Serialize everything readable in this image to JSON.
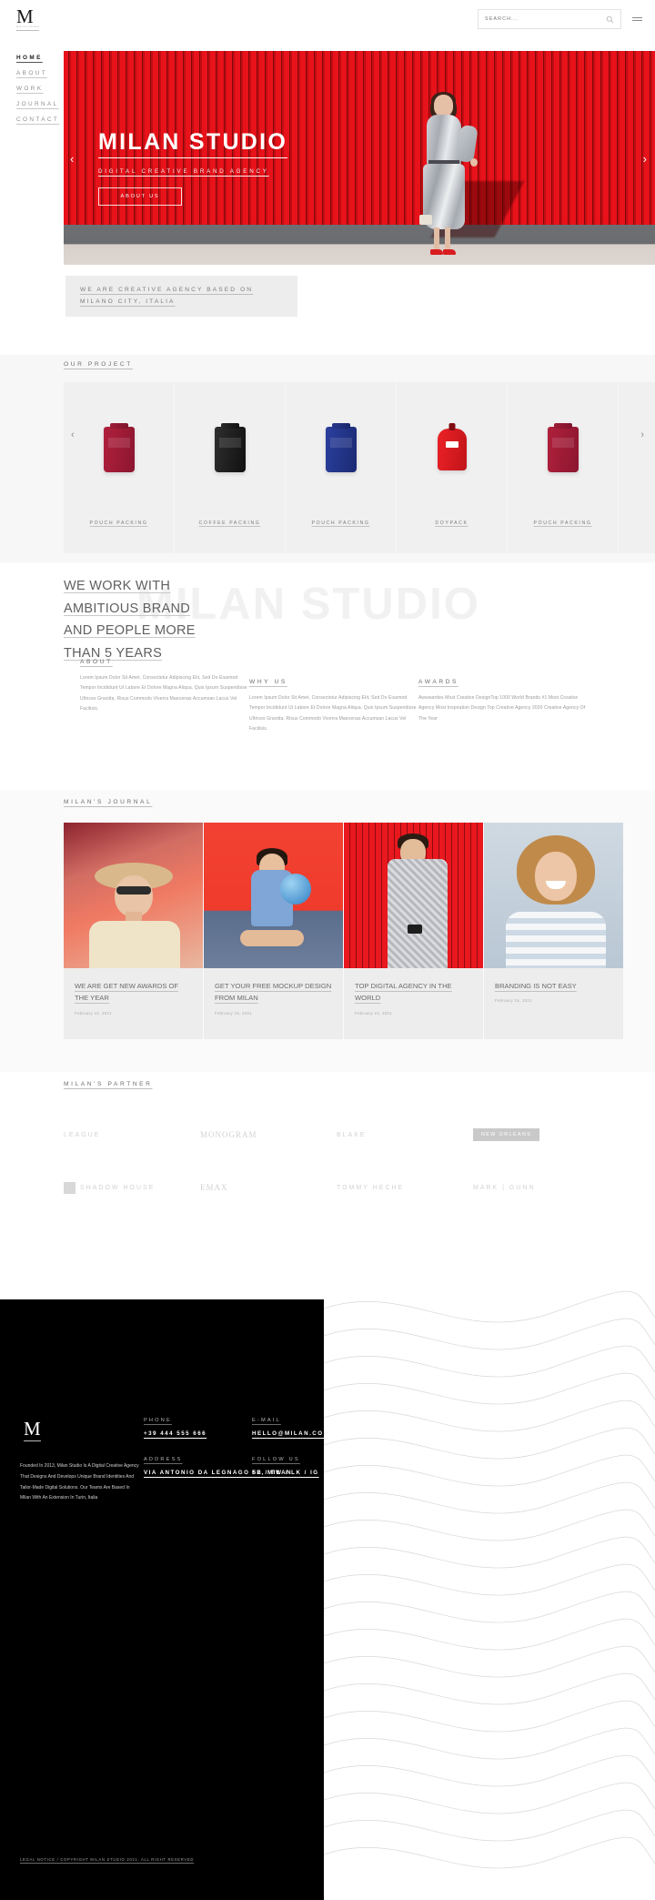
{
  "brand": {
    "logo": "M",
    "logo_sub": "MILAN STUDIO"
  },
  "topbar": {
    "search_placeholder": "SEARCH...",
    "search_value": "",
    "search_icon": "search-icon",
    "menu_icon": "hamburger-icon"
  },
  "nav": {
    "items": [
      {
        "label": "HOME",
        "active": true
      },
      {
        "label": "ABOUT",
        "active": false
      },
      {
        "label": "WORK",
        "active": false
      },
      {
        "label": "JOURNAL",
        "active": false
      },
      {
        "label": "CONTACT",
        "active": false
      }
    ]
  },
  "hero": {
    "title": "MILAN STUDIO",
    "subtitle": "DIGITAL CREATIVE BRAND AGENCY",
    "button": "ABOUT US",
    "prev_icon": "chevron-left-icon",
    "next_icon": "chevron-right-icon",
    "prev_glyph": "‹",
    "next_glyph": "›"
  },
  "tagline": {
    "line1": "WE ARE CREATIVE AGENCY BASED ON",
    "line2": "MILANO CITY, ITALIA"
  },
  "projects": {
    "heading": "OUR PROJECT",
    "prev_glyph": "‹",
    "next_glyph": "›",
    "items": [
      {
        "label": "POUCH PACKING",
        "style": "p-red"
      },
      {
        "label": "COFFEE PACKING",
        "style": "p-black"
      },
      {
        "label": "POUCH PACKING",
        "style": "p-blue"
      },
      {
        "label": "DOYPACK",
        "style": "p-doy"
      },
      {
        "label": "POUCH PACKING",
        "style": "p-red"
      }
    ]
  },
  "work": {
    "ghost_text": "MILAN STUDIO",
    "title_lines": [
      "WE WORK WITH",
      "AMBITIOUS BRAND",
      "AND PEOPLE MORE",
      "THAN 5 YEARS"
    ],
    "columns": [
      {
        "heading": "ABOUT",
        "body": "Lorem Ipsum Dolor Sit Amet, Consectetur Adipiscing Elit, Sed Do Eiusmod Tempor Incididunt Ut Labore Et Dolore Magna Aliqua. Quis Ipsum Suspendisse Ultrices Gravida. Risus Commodo Viverra Maecenas Accumsan Lacus Vel Facilisis."
      },
      {
        "heading": "WHY US",
        "body": "Lorem Ipsum Dolor Sit Amet, Consectetur Adipiscing Elit, Sed Do Eiusmod Tempor Incididunt Ut Labore Et Dolore Magna Aliqua. Quis Ipsum Suspendisse Ultrices Gravida. Risus Commodo Viverra Maecenas Accumsan Lacus Vel Facilisis."
      },
      {
        "heading": "AWARDS",
        "body": "Awwwardes Most Creative DesignTop 1000 World Brands #1 Most Creative Agency Most Inspiration Design Top Creative Agency 2020 Creative Agency Of The Year"
      }
    ]
  },
  "journal": {
    "heading": "MILAN'S JOURNAL",
    "items": [
      {
        "title": "WE ARE GET NEW AWARDS OF THE YEAR",
        "date": "February 15, 2021",
        "photo": "ph1"
      },
      {
        "title": "GET YOUR FREE MOCKUP DESIGN FROM MILAN",
        "date": "February 15, 2021",
        "photo": "ph2"
      },
      {
        "title": "TOP DIGITAL AGENCY IN THE WORLD",
        "date": "February 15, 2021",
        "photo": "ph3"
      },
      {
        "title": "BRANDING IS NOT EASY",
        "date": "February 15, 2021",
        "photo": "ph4"
      }
    ]
  },
  "partners": {
    "heading": "MILAN'S PARTNER",
    "items": [
      {
        "label": "LEAGUE",
        "kind": "text"
      },
      {
        "label": "MONOGRAM",
        "kind": "serif"
      },
      {
        "label": "BLAKE",
        "kind": "text"
      },
      {
        "label": "NEW ORLEANS",
        "kind": "badge"
      },
      {
        "label": "SHADOW HOUSE",
        "kind": "square"
      },
      {
        "label": "EMAX",
        "kind": "text"
      },
      {
        "label": "TOMMY HECHE",
        "kind": "text"
      },
      {
        "label": "MARK | GUNN",
        "kind": "text"
      }
    ]
  },
  "footer": {
    "logo": "M",
    "description": "Founded In 2013, Milan Studio Is A Digital Creative Agency That Designs And Develops Unique Brand Identities And Tailor-Made Digital Solutions. Our Teams Are Based In Milan With An Extension In Turin, Italia",
    "phone_label": "PHONE",
    "phone_value": "+39 444 555 666",
    "address_label": "ADDRESS",
    "address_value": "VIA ANTONIO DA LEGNAGO 52, MILAN",
    "email_label": "E-MAIL",
    "email_value": "HELLO@MILAN.COM",
    "follow_label": "FOLLOW US",
    "follow_value": "FB / TW / LK / IG",
    "copyright": "LEGAL NOTICE / COPYRIGHT MILAN STUDIO 2021. ALL RIGHT RESERVED"
  },
  "colors": {
    "accent_red": "#e8121a",
    "dark": "#000000",
    "muted": "#9a9a9a"
  }
}
